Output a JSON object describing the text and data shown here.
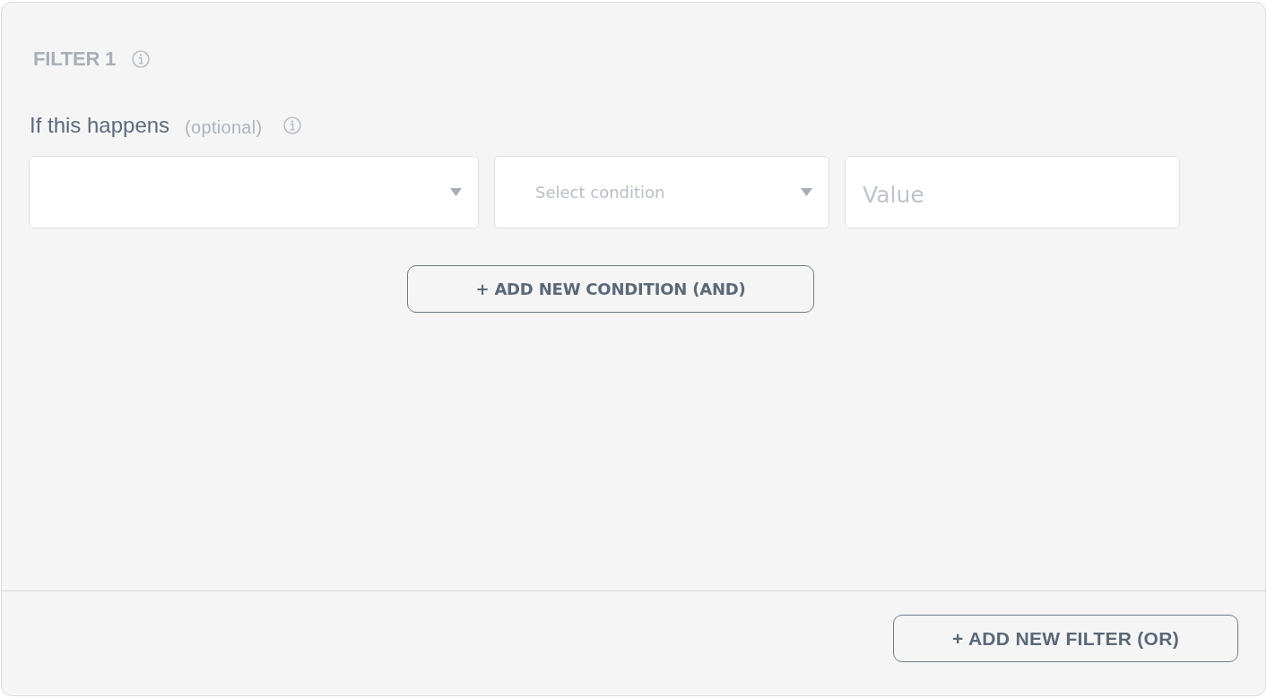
{
  "filter": {
    "title": "FILTER 1",
    "condition_group": {
      "label": "If this happens",
      "hint": "(optional)",
      "fields": [
        {
          "kind": "dropdown"
        },
        {
          "kind": "dropdown",
          "placeholder": "Select condition"
        },
        {
          "kind": "text",
          "placeholder": "Value"
        }
      ],
      "add_button": "+ ADD NEW CONDITION (AND)"
    }
  },
  "footer": {
    "add_button": "+ ADD NEW FILTER (OR)"
  }
}
